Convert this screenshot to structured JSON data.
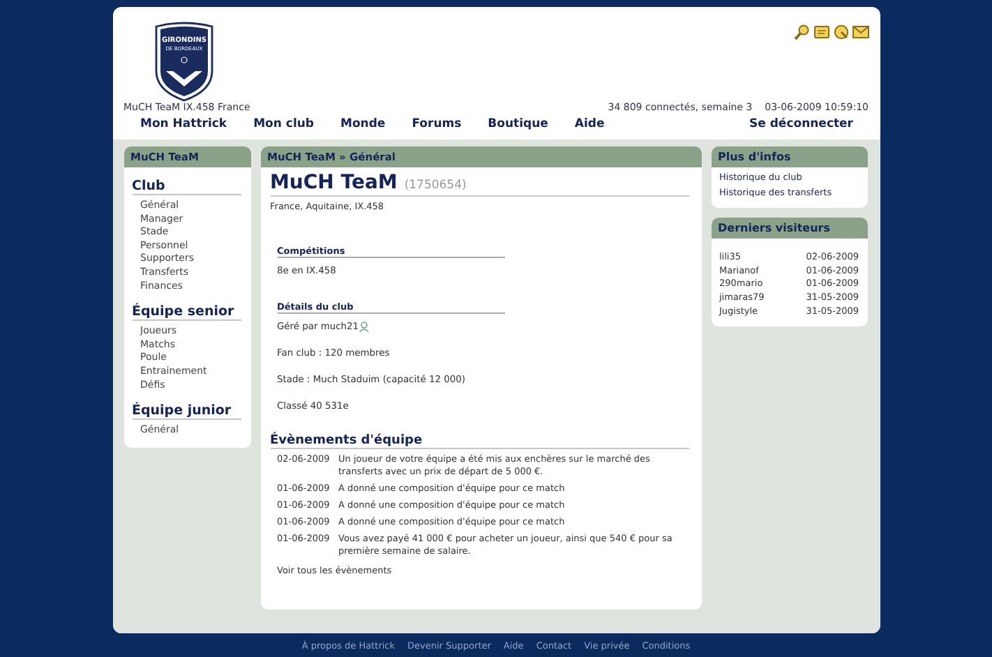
{
  "header": {
    "logo": {
      "line1": "GIRONDINS",
      "line2": "DE BORDEAUX"
    },
    "team_line": "MuCH TeaM IX.458 France",
    "stats": "34 809 connectés, semaine 3",
    "datetime": "03-06-2009 10:59:10",
    "nav": [
      "Mon Hattrick",
      "Mon club",
      "Monde",
      "Forums",
      "Boutique",
      "Aide"
    ],
    "logout": "Se déconnecter"
  },
  "left_panel": {
    "title": "MuCH TeaM",
    "sections": [
      {
        "heading": "Club",
        "items": [
          "Général",
          "Manager",
          "Stade",
          "Personnel",
          "Supporters",
          "Transferts",
          "Finances"
        ]
      },
      {
        "heading": "Équipe senior",
        "items": [
          "Joueurs",
          "Matchs",
          "Poule",
          "Entrainement",
          "Défis"
        ]
      },
      {
        "heading": "Équipe junior",
        "items": [
          "Général"
        ]
      }
    ]
  },
  "main": {
    "breadcrumb": "MuCH TeaM » Général",
    "team_name": "MuCH TeaM",
    "team_id": "(1750654)",
    "location": "France, Aquitaine, IX.458",
    "competitions": {
      "heading": "Compétitions",
      "lines": [
        "8e en IX.458"
      ]
    },
    "details": {
      "heading": "Détails du club",
      "manager": "Géré par much21",
      "lines": [
        "Fan club : 120 membres",
        "Stade : Much Staduim (capacité 12 000)",
        "Classé 40 531e"
      ]
    },
    "events": {
      "heading": "Évènements d'équipe",
      "items": [
        {
          "date": "02-06-2009",
          "text": "Un joueur de votre équipe a été mis aux enchères sur le marché des transferts avec un prix de départ de 5 000 €."
        },
        {
          "date": "01-06-2009",
          "text": "A donné une composition d'équipe pour ce match"
        },
        {
          "date": "01-06-2009",
          "text": "A donné une composition d'équipe pour ce match"
        },
        {
          "date": "01-06-2009",
          "text": "A donné une composition d'équipe pour ce match"
        },
        {
          "date": "01-06-2009",
          "text": "Vous avez payé 41 000 € pour acheter un joueur, ainsi que 540 € pour sa première semaine de salaire."
        }
      ],
      "link": "Voir tous les évènements"
    }
  },
  "right_panels": {
    "info": {
      "title": "Plus d'infos",
      "links": [
        "Historique du club",
        "Historique des transferts"
      ]
    },
    "visitors": {
      "title": "Derniers visiteurs",
      "items": [
        {
          "name": "lili35",
          "date": "02-06-2009"
        },
        {
          "name": "Marianof",
          "date": "01-06-2009"
        },
        {
          "name": "290mario",
          "date": "01-06-2009"
        },
        {
          "name": "jimaras79",
          "date": "31-05-2009"
        },
        {
          "name": "Jugistyle",
          "date": "31-05-2009"
        }
      ]
    }
  },
  "footer": [
    "À propos de Hattrick",
    "Devenir Supporter",
    "Aide",
    "Contact",
    "Vie privée",
    "Conditions"
  ]
}
